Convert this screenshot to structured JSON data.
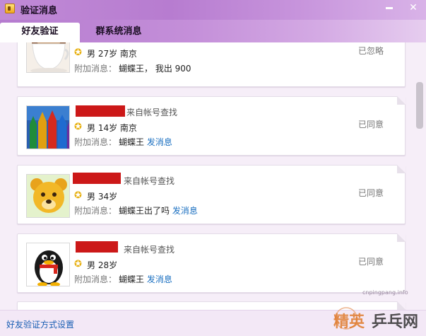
{
  "window": {
    "title": "验证消息",
    "minimize_icon": "minimize-icon",
    "close_icon": "close-icon",
    "close_glyph": "✕"
  },
  "tabs": [
    {
      "label": "好友验证",
      "active": true
    },
    {
      "label": "群系统消息",
      "active": false
    }
  ],
  "messages": [
    {
      "avatar": "coffee-cup-avatar",
      "name_redacted": true,
      "source": "",
      "gender_age_city": "男 27岁 南京",
      "extra_label": "附加消息：",
      "extra_value": "蝴蝶王， 我出 900",
      "send_link": "",
      "status": "已忽略"
    },
    {
      "avatar": "colored-pencils-avatar",
      "name_redacted": true,
      "source": "来自帐号查找",
      "gender_age_city": "男 14岁 南京",
      "extra_label": "附加消息：",
      "extra_value": "蝴蝶王",
      "send_link": "发消息",
      "status": "已同意"
    },
    {
      "avatar": "teddy-bear-avatar",
      "name_redacted": true,
      "source": "来自帐号查找",
      "gender_age_city": "男 34岁",
      "extra_label": "附加消息：",
      "extra_value": "蝴蝶王出了吗",
      "send_link": "发消息",
      "status": "已同意"
    },
    {
      "avatar": "penguin-avatar",
      "name_redacted": true,
      "source": "来自帐号查找",
      "gender_age_city": "男 28岁",
      "extra_label": "附加消息：",
      "extra_value": "蝴蝶王",
      "send_link": "发消息",
      "status": "已同意"
    }
  ],
  "footer": {
    "settings_link": "好友验证方式设置"
  },
  "watermark": {
    "url": "cnpingpang.info",
    "brand": "精英乒乓网"
  },
  "colors": {
    "title_bar": "#c08ad6",
    "content_bg": "#f6eef8",
    "link": "#1a6fc0",
    "redaction": "#cc1818",
    "star": "#e7b010"
  }
}
